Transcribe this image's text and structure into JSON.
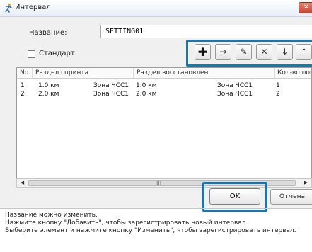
{
  "window": {
    "title": "Интервал",
    "icon": "runner-icon",
    "close_glyph": "✕"
  },
  "form": {
    "name_label": "Название:",
    "name_value": "SETTING01",
    "standard_checkbox": {
      "label": "Стандарт",
      "checked": false
    }
  },
  "toolbar": {
    "add_glyph": "✚",
    "right_glyph": "→",
    "edit_glyph": "✎",
    "delete_glyph": "✕",
    "down_glyph": "↓",
    "up_glyph": "↑"
  },
  "table": {
    "columns": [
      "No.",
      "Раздел спринта",
      "",
      "Раздел восстановления",
      "",
      "Кол-во повтор"
    ],
    "rows": [
      [
        "1",
        "1.0 км",
        "Зона ЧСС1",
        "1.0 км",
        "Зона ЧСС1",
        "1"
      ],
      [
        "2",
        "2.0 км",
        "Зона ЧСС1",
        "2.0 км",
        "Зона ЧСС1",
        "2"
      ]
    ],
    "scroll_left_glyph": "◀",
    "scroll_grip_glyph": "III",
    "scroll_right_glyph": "▶"
  },
  "buttons": {
    "ok": "OK",
    "cancel": "Отмена"
  },
  "help": [
    "Название можно изменить.",
    "Нажмите кнопку \"Добавить\", чтобы зарегистрировать новый интервал.",
    "Выберите элемент и нажмите кнопку \"Изменить\", чтобы зарегистрировать интервал."
  ],
  "colors": {
    "highlight": "#1577b3",
    "dialog_bg": "#f0f0f0",
    "close_button": "#c8452f"
  }
}
